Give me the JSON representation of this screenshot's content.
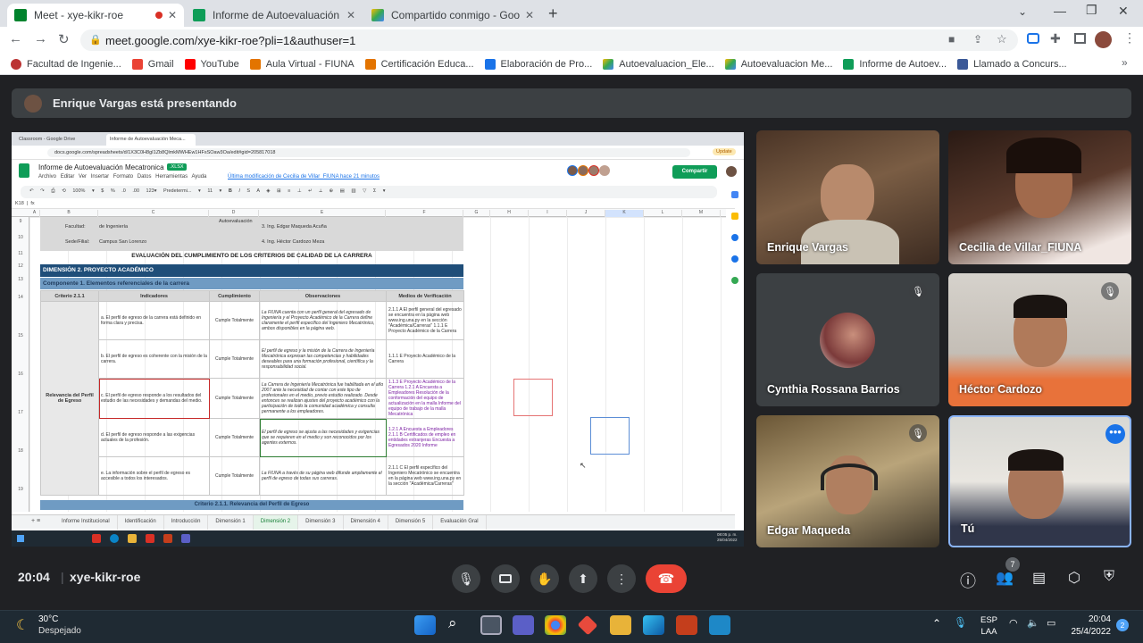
{
  "browser": {
    "tabs": [
      {
        "label": "Meet - xye-kikr-roe",
        "active": true
      },
      {
        "label": "Informe de Autoevaluación Meca",
        "active": false
      },
      {
        "label": "Compartido conmigo - Google D",
        "active": false
      }
    ],
    "url": "meet.google.com/xye-kikr-roe?pli=1&authuser=1",
    "bookmarks": [
      "Facultad de Ingenie...",
      "Gmail",
      "YouTube",
      "Aula Virtual - FIUNA",
      "Certificación Educa...",
      "Elaboración de Pro...",
      "Autoevaluacion_Ele...",
      "Autoevaluacion Me...",
      "Informe de Autoev...",
      "Llamado a Concurs..."
    ]
  },
  "presenter_bar": {
    "text": "Enrique Vargas está presentando"
  },
  "shared_screen": {
    "tabs": [
      "Classroom - Google Drive",
      "Informe de Autoevaluación Meca..."
    ],
    "url": "docs.google.com/spreadsheets/d/1X3C0H8gI1Zb8QlmkMWHEw1HFsSOaw3Oa/edit#gid=205817018",
    "doc_title": "Informe de Autoevaluación Mecatronica",
    "doc_badge": ".XLSX",
    "menus": [
      "Archivo",
      "Editar",
      "Ver",
      "Insertar",
      "Formato",
      "Datos",
      "Herramientas",
      "Ayuda"
    ],
    "last_edit": "Última modificación de Cecilia de Villar_FIUNA hace 21 minutos",
    "share_label": "Compartir",
    "update_label": "Update",
    "zoom": "100%",
    "font": "Predetermi...",
    "font_size": "11",
    "cell_ref": "K18",
    "col_headers": [
      "A",
      "B",
      "C",
      "D",
      "E",
      "F",
      "G",
      "H",
      "I",
      "J",
      "K",
      "L",
      "M"
    ],
    "row_numbers": [
      "9",
      "10",
      "11",
      "12",
      "13",
      "14",
      "15",
      "16",
      "17",
      "18",
      "19",
      "20",
      "21"
    ],
    "row9": {
      "b": "Facultad:",
      "c": "de Ingeniería",
      "d": "Autoevaluación",
      "e": "3. Ing. Edgar Maqueda Acuña"
    },
    "row10": {
      "b": "Sede/Filial:",
      "c": "Campus San Lorenzo",
      "e": "4. Ing. Héctor Cardozo Meza"
    },
    "sheet_title": "EVALUACIÓN DEL CUMPLIMIENTO DE LOS CRITERIOS DE CALIDAD DE LA CARRERA",
    "dimension": "DIMENSIÓN 2. PROYECTO ACADÉMICO",
    "component": "Componente 1. Elementos referenciales de la carrera",
    "table_headers": [
      "Criterio 2.1.1",
      "Indicadores",
      "Cumplimiento",
      "Observaciones",
      "Medios de Verificación"
    ],
    "criterion_label": "Relevancia del Perfil de Egreso",
    "rows": [
      {
        "ind": "a. El perfil de egreso de la carrera está definido en forma clara y precisa.",
        "cum": "Cumple Totalmente",
        "obs": "La FIUNA cuenta con un perfil general del egresado de Ingeniería y el Proyecto Académico de la Carrera define claramente el perfil específico del Ingeniero Mecatrónico, ambos disponibles en la página web.",
        "med": "2.1.1 A El perfil general del egresado se encuentra en la página web www.ing.una.py en la sección \"Académica/Carreras\" 1.1.1 E Proyecto Académico de la Carrera"
      },
      {
        "ind": "b. El perfil de egreso es coherente con la misión de la carrera.",
        "cum": "Cumple Totalmente",
        "obs": "El perfil de egreso y la misión de la Carrera de Ingeniería Mecatrónica expresan las competencias y habilidades deseables para una formación profesional, científica y la responsabilidad social.",
        "med": "1.1.1 E Proyecto Académico de la Carrera"
      },
      {
        "ind": "c. El perfil de egreso responde a los resultados del estudio de las necesidades y demandas del medio.",
        "cum": "Cumple Totalmente",
        "obs": "La Carrera de Ingeniería Mecatrónica fue habilitada en el año 2007 ante la necesidad de contar con este tipo de profesionales en el medio, previo estudio realizado. Desde entonces se realizan ajustes del proyecto académico con la participación de todo la comunidad académica y consulta permanente a los empleadores.",
        "med": "1.1.3 E Proyecto Académico de la Carrera 1.2.1 A Encuesta a Empleadores Resolución de la conformación del equipo de actualización en la malla Informe del equipo de trabajo de la malla Mecatrónica"
      },
      {
        "ind": "d. El perfil de egreso responde a las exigencias actuales de la profesión.",
        "cum": "Cumple Totalmente",
        "obs": "El perfil de egreso se ajusta a las necesidades y exigencias que se requieren en el medio y son reconocidos por los agentes externos.",
        "med": "1.2.1 A Encuesta a Empleadores 2.1.1 B Certificados de empleo en entidades extranjeras Encuesta a Egresados 2020 Informe"
      },
      {
        "ind": "e. La información sobre el perfil de egreso es accesible a todos los interesados.",
        "cum": "Cumple Totalmente",
        "obs": "La FIUNA a través de su página web difunde ampliamente el perfil de egreso de todas sus carreras.",
        "med": "2.1.1 C El perfil específico del Ingeniero Mecatrónico se encuentra en la página web www.ing.una.py en la sección \"Académica/Carreras\""
      }
    ],
    "next_criterion": "Criterio 2.1.1. Relevancia del Perfil de Egreso",
    "sheet_tabs": [
      "Informe Institucional",
      "Identificación",
      "Introducción",
      "Dimensión 1",
      "Dimensión 2",
      "Dimensión 3",
      "Dimensión 4",
      "Dimensión 5",
      "Evaluación Gral"
    ],
    "active_sheet": "Dimensión 2",
    "inner_clock": {
      "time": "08:05 p. m.",
      "date": "25/04/2022"
    }
  },
  "participants": [
    {
      "name": "Enrique Vargas",
      "muted": false
    },
    {
      "name": "Cecilia de Villar_FIUNA",
      "muted": false
    },
    {
      "name": "Cynthia Rossana Barrios",
      "muted": true
    },
    {
      "name": "Héctor Cardozo",
      "muted": true
    },
    {
      "name": "Edgar Maqueda",
      "muted": true
    },
    {
      "name": "Tú",
      "muted": false
    }
  ],
  "meeting": {
    "time": "20:04",
    "code": "xye-kikr-roe",
    "people_count": "7"
  },
  "colors": {
    "end_call": "#ea4335",
    "meet_bg": "#202124",
    "sheet_header": "#4f6e8f",
    "dimension_bg": "#1f4e79"
  },
  "taskbar": {
    "weather_temp": "30°C",
    "weather_desc": "Despejado",
    "lang": "ESP",
    "lang2": "LAA",
    "time": "20:04",
    "date": "25/4/2022",
    "notif": "2"
  }
}
